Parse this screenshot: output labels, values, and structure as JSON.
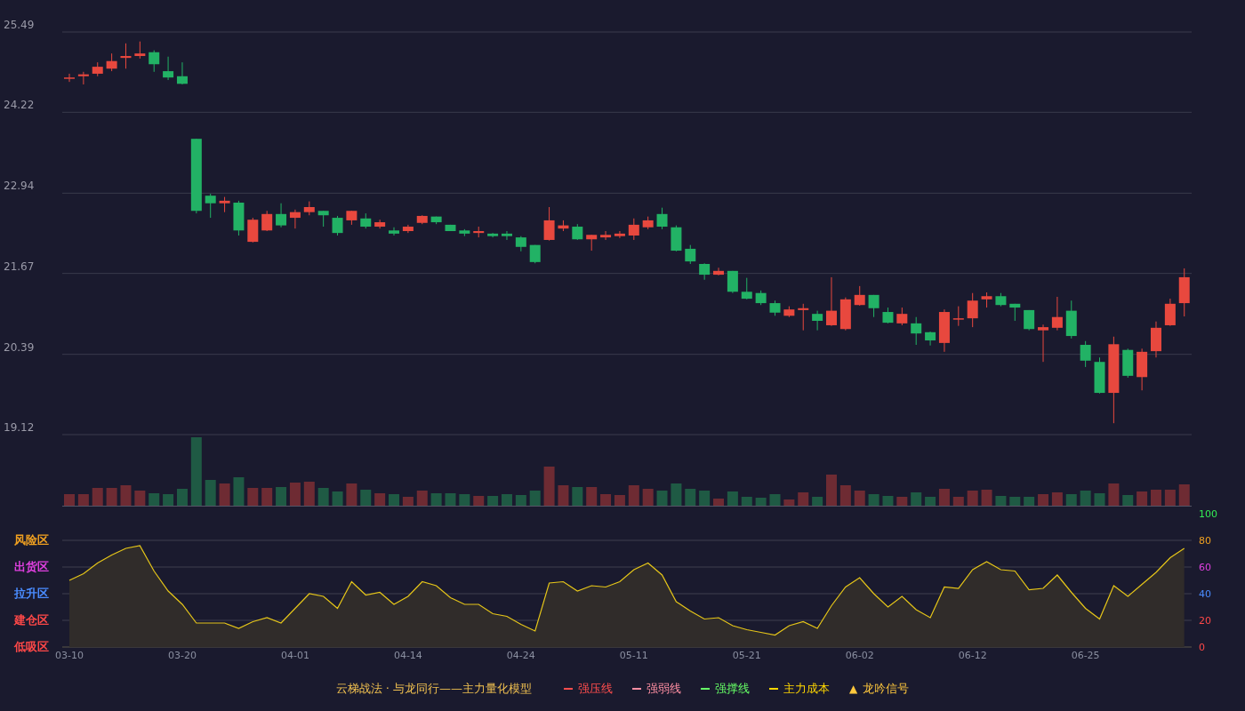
{
  "price_chart": {
    "chart_data": {
      "type": "candlestick",
      "grid": true,
      "yticks": [
        25.49,
        24.22,
        22.94,
        21.67,
        20.39,
        19.12
      ],
      "ylim": [
        19.12,
        25.49
      ],
      "ohlc": [
        [
          24.77,
          24.83,
          24.7,
          24.77
        ],
        [
          24.79,
          24.86,
          24.66,
          24.82
        ],
        [
          24.83,
          25.01,
          24.79,
          24.94
        ],
        [
          24.91,
          25.15,
          24.87,
          25.03
        ],
        [
          25.08,
          25.31,
          24.91,
          25.11
        ],
        [
          25.11,
          25.34,
          25.07,
          25.15
        ],
        [
          25.17,
          25.2,
          24.86,
          24.98
        ],
        [
          24.87,
          25.1,
          24.73,
          24.77
        ],
        [
          24.79,
          25.01,
          24.66,
          24.67
        ],
        [
          23.8,
          23.8,
          22.62,
          22.66
        ],
        [
          22.9,
          22.93,
          22.55,
          22.78
        ],
        [
          22.78,
          22.88,
          22.64,
          22.82
        ],
        [
          22.79,
          22.82,
          22.27,
          22.35
        ],
        [
          22.17,
          22.55,
          22.16,
          22.52
        ],
        [
          22.35,
          22.66,
          22.34,
          22.61
        ],
        [
          22.61,
          22.78,
          22.4,
          22.43
        ],
        [
          22.55,
          22.68,
          22.38,
          22.64
        ],
        [
          22.64,
          22.81,
          22.59,
          22.72
        ],
        [
          22.66,
          22.66,
          22.41,
          22.59
        ],
        [
          22.55,
          22.58,
          22.27,
          22.31
        ],
        [
          22.51,
          22.66,
          22.44,
          22.66
        ],
        [
          22.54,
          22.62,
          22.38,
          22.41
        ],
        [
          22.41,
          22.52,
          22.38,
          22.48
        ],
        [
          22.35,
          22.4,
          22.27,
          22.3
        ],
        [
          22.34,
          22.44,
          22.31,
          22.41
        ],
        [
          22.47,
          22.59,
          22.45,
          22.58
        ],
        [
          22.57,
          22.57,
          22.45,
          22.48
        ],
        [
          22.44,
          22.44,
          22.34,
          22.34
        ],
        [
          22.35,
          22.37,
          22.26,
          22.3
        ],
        [
          22.31,
          22.41,
          22.24,
          22.34
        ],
        [
          22.3,
          22.31,
          22.24,
          22.26
        ],
        [
          22.3,
          22.34,
          22.2,
          22.26
        ],
        [
          22.24,
          22.26,
          22.02,
          22.09
        ],
        [
          22.12,
          22.12,
          21.83,
          21.85
        ],
        [
          22.2,
          22.72,
          22.19,
          22.51
        ],
        [
          22.38,
          22.51,
          22.34,
          22.43
        ],
        [
          22.41,
          22.45,
          22.2,
          22.21
        ],
        [
          22.21,
          22.28,
          22.03,
          22.28
        ],
        [
          22.24,
          22.34,
          22.2,
          22.28
        ],
        [
          22.26,
          22.34,
          22.23,
          22.3
        ],
        [
          22.27,
          22.54,
          22.2,
          22.44
        ],
        [
          22.4,
          22.57,
          22.37,
          22.51
        ],
        [
          22.61,
          22.71,
          22.37,
          22.41
        ],
        [
          22.4,
          22.43,
          22.02,
          22.03
        ],
        [
          22.06,
          22.12,
          21.82,
          21.86
        ],
        [
          21.82,
          21.83,
          21.57,
          21.65
        ],
        [
          21.65,
          21.76,
          21.64,
          21.71
        ],
        [
          21.71,
          21.71,
          21.36,
          21.38
        ],
        [
          21.38,
          21.6,
          21.26,
          21.27
        ],
        [
          21.36,
          21.4,
          21.17,
          21.2
        ],
        [
          21.2,
          21.24,
          21.0,
          21.05
        ],
        [
          21.0,
          21.15,
          20.98,
          21.1
        ],
        [
          21.09,
          21.19,
          20.77,
          21.12
        ],
        [
          21.03,
          21.08,
          20.77,
          20.92
        ],
        [
          20.85,
          21.61,
          20.84,
          21.08
        ],
        [
          20.79,
          21.29,
          20.77,
          21.26
        ],
        [
          21.17,
          21.47,
          21.16,
          21.33
        ],
        [
          21.33,
          21.33,
          20.98,
          21.12
        ],
        [
          21.06,
          21.13,
          20.88,
          20.89
        ],
        [
          20.88,
          21.13,
          20.85,
          21.03
        ],
        [
          20.88,
          20.98,
          20.54,
          20.72
        ],
        [
          20.74,
          20.75,
          20.53,
          20.61
        ],
        [
          20.57,
          21.1,
          20.43,
          21.06
        ],
        [
          20.95,
          21.15,
          20.84,
          20.96
        ],
        [
          20.96,
          21.36,
          20.82,
          21.24
        ],
        [
          21.26,
          21.37,
          21.13,
          21.31
        ],
        [
          21.31,
          21.36,
          21.15,
          21.17
        ],
        [
          21.19,
          21.19,
          20.92,
          21.13
        ],
        [
          21.09,
          21.09,
          20.77,
          20.79
        ],
        [
          20.77,
          20.86,
          20.27,
          20.82
        ],
        [
          20.81,
          21.3,
          20.77,
          20.98
        ],
        [
          21.08,
          21.24,
          20.64,
          20.68
        ],
        [
          20.54,
          20.6,
          20.19,
          20.29
        ],
        [
          20.27,
          20.34,
          19.77,
          19.78
        ],
        [
          19.78,
          20.67,
          19.3,
          20.55
        ],
        [
          20.46,
          20.48,
          20.02,
          20.05
        ],
        [
          20.03,
          20.48,
          19.82,
          20.43
        ],
        [
          20.44,
          20.91,
          20.34,
          20.81
        ],
        [
          20.85,
          21.27,
          20.84,
          21.19
        ],
        [
          21.2,
          21.75,
          20.99,
          21.61
        ]
      ]
    }
  },
  "oscillator": {
    "zones": [
      {
        "label": "风险区",
        "color": "#f0a020"
      },
      {
        "label": "出货区",
        "color": "#e040e0"
      },
      {
        "label": "拉升区",
        "color": "#4a8cff"
      },
      {
        "label": "建仓区",
        "color": "#ff4848"
      },
      {
        "label": "低吸区",
        "color": "#ff4848"
      }
    ],
    "tick_colors": [
      {
        "color": "#33ee55"
      },
      {
        "color": "#f0a020"
      },
      {
        "color": "#e040e0"
      },
      {
        "color": "#4a8cff"
      },
      {
        "color": "#ff4848"
      },
      {
        "color": "#ff4848"
      }
    ],
    "chart_data": {
      "type": "area",
      "grid": true,
      "ylim": [
        0,
        100
      ],
      "yticks": [
        100,
        80,
        60,
        40,
        20,
        0
      ],
      "categories": [
        "03-10",
        null,
        null,
        null,
        null,
        null,
        null,
        null,
        "03-20",
        null,
        null,
        null,
        null,
        null,
        null,
        null,
        "04-01",
        null,
        null,
        null,
        null,
        null,
        null,
        null,
        "04-14",
        null,
        null,
        null,
        null,
        null,
        null,
        null,
        "04-24",
        null,
        null,
        null,
        null,
        null,
        null,
        null,
        "05-11",
        null,
        null,
        null,
        null,
        null,
        null,
        null,
        "05-21",
        null,
        null,
        null,
        null,
        null,
        null,
        null,
        "06-02",
        null,
        null,
        null,
        null,
        null,
        null,
        null,
        "06-12",
        null,
        null,
        null,
        null,
        null,
        null,
        null,
        "06-25",
        null,
        null,
        null,
        null,
        null,
        null,
        null
      ],
      "series": [
        {
          "color": "#e6c619",
          "values": [
            50,
            55,
            63,
            69,
            74,
            76,
            57,
            42,
            32,
            18,
            18,
            18,
            14,
            19,
            22,
            18,
            29,
            40,
            38,
            29,
            49,
            39,
            41,
            32,
            38,
            49,
            46,
            37,
            32,
            32,
            25,
            23,
            17,
            12,
            48,
            49,
            42,
            46,
            45,
            49,
            58,
            63,
            54,
            34,
            27,
            21,
            22,
            16,
            13,
            11,
            9,
            16,
            19,
            14,
            31,
            45,
            52,
            40,
            30,
            38,
            28,
            22,
            45,
            44,
            58,
            64,
            58,
            57,
            43,
            44,
            54,
            41,
            29,
            21,
            46,
            38,
            47,
            56,
            67,
            74
          ]
        }
      ]
    }
  },
  "legend": {
    "title": "云梯战法 · 与龙同行——主力量化模型",
    "items": [
      {
        "kind": "line",
        "label": "强压线",
        "color": "#ff4d4d"
      },
      {
        "kind": "dashed",
        "label": "强弱线",
        "color": "#ff8fa3"
      },
      {
        "kind": "line",
        "label": "强撑线",
        "color": "#66ff66"
      },
      {
        "kind": "dashed",
        "label": "主力成本",
        "color": "#ffd700"
      },
      {
        "kind": "triangle",
        "symbol": "▲",
        "label": "龙吟信号",
        "color": "#ffc83d"
      }
    ]
  }
}
